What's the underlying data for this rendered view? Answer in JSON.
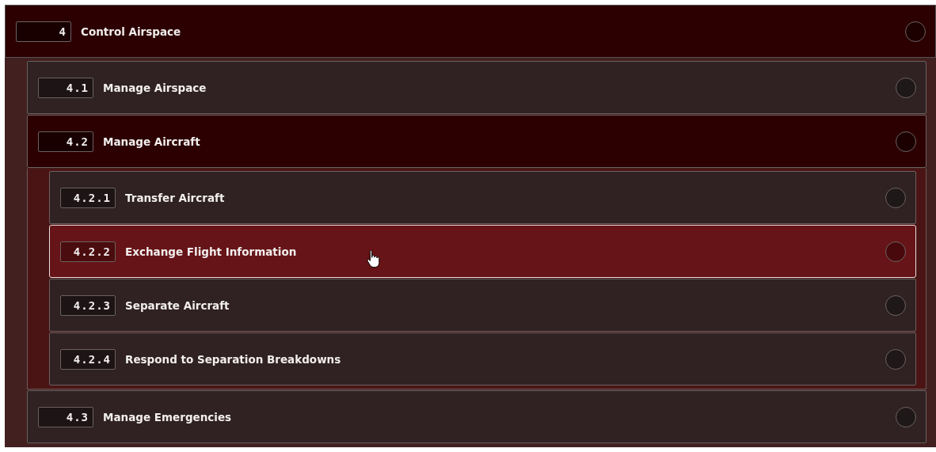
{
  "tree": [
    {
      "number": "4",
      "label": "Control Airspace",
      "expanded": true,
      "selected": false,
      "children": [
        {
          "number": "4.1",
          "label": "Manage Airspace",
          "expanded": false,
          "selected": false
        },
        {
          "number": "4.2",
          "label": "Manage Aircraft",
          "expanded": true,
          "selected": false,
          "children": [
            {
              "number": "4.2.1",
              "label": "Transfer Aircraft",
              "expanded": false,
              "selected": false
            },
            {
              "number": "4.2.2",
              "label": "Exchange Flight Information",
              "expanded": false,
              "selected": true
            },
            {
              "number": "4.2.3",
              "label": "Separate Aircraft",
              "expanded": false,
              "selected": false
            },
            {
              "number": "4.2.4",
              "label": "Respond to Separation Breakdowns",
              "expanded": false,
              "selected": false
            }
          ]
        },
        {
          "number": "4.3",
          "label": "Manage Emergencies",
          "expanded": false,
          "selected": false
        }
      ]
    }
  ]
}
